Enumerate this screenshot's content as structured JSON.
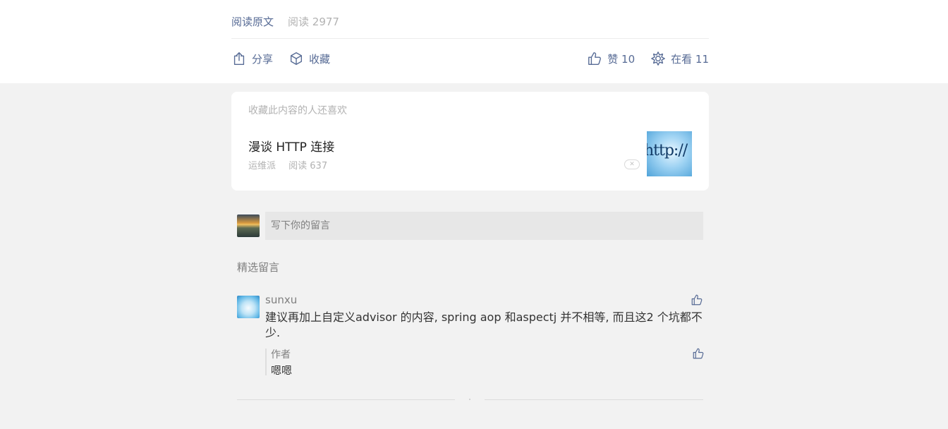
{
  "article_footer": {
    "read_original": "阅读原文",
    "read_count": "阅读 2977",
    "share_label": "分享",
    "favorite_label": "收藏",
    "like_label": "赞 10",
    "watching_label": "在看 11"
  },
  "recommendation": {
    "header": "收藏此内容的人还喜欢",
    "item": {
      "title": "漫谈 HTTP 连接",
      "source": "运维派",
      "read_count": "阅读 637",
      "dismiss": "✕",
      "thumbnail_text": "http://"
    }
  },
  "comment_box": {
    "placeholder": "写下你的留言"
  },
  "comments": {
    "heading": "精选留言",
    "items": [
      {
        "nickname": "sunxu",
        "content": "建议再加上自定义advisor 的内容, spring aop 和aspectj 并不相等, 而且这2 个坑都不少.",
        "reply": {
          "author": "作者",
          "content": "嗯嗯"
        }
      }
    ]
  },
  "colors": {
    "link_blue": "#576b95",
    "muted_gray": "#b2b2b2",
    "page_background": "#f2f2f2"
  },
  "icons": {
    "share": "share-icon",
    "favorite": "favorite-cube-icon",
    "like": "thumbs-up-icon",
    "watching": "watching-flower-icon"
  }
}
